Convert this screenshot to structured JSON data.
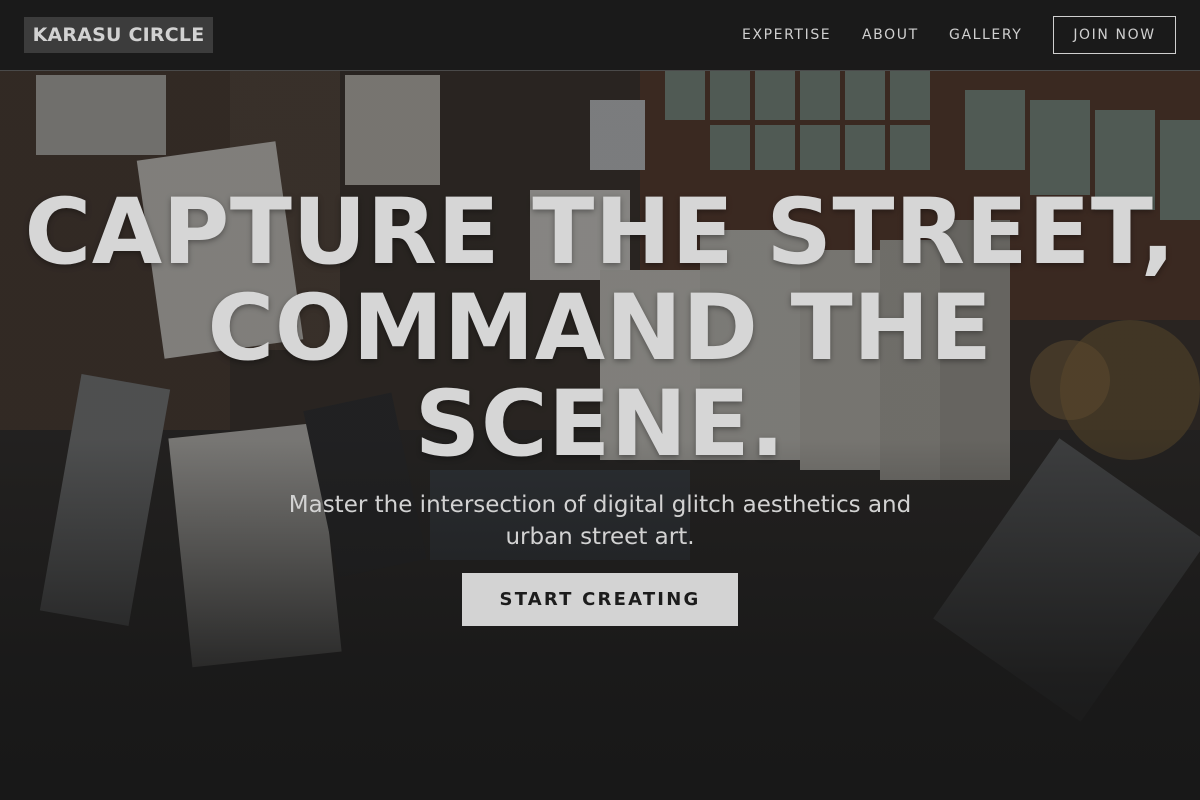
{
  "brand": {
    "name": "KARASU CIRCLE"
  },
  "nav": {
    "items": [
      {
        "label": "EXPERTISE"
      },
      {
        "label": "ABOUT"
      },
      {
        "label": "GALLERY"
      }
    ],
    "cta_label": "JOIN NOW"
  },
  "hero": {
    "title_lines": [
      "CAPTURE THE STREET,",
      "COMMAND THE",
      "SCENE."
    ],
    "subtitle": "Master the intersection of digital glitch aesthetics and urban street art.",
    "cta_label": "START CREATING",
    "background_image": "artist-loft-photo"
  },
  "colors": {
    "background": "#1a1a1a",
    "text": "#d6d6d6",
    "cta_background": "#d3d3d3",
    "logo_background": "#3c3c3c"
  }
}
